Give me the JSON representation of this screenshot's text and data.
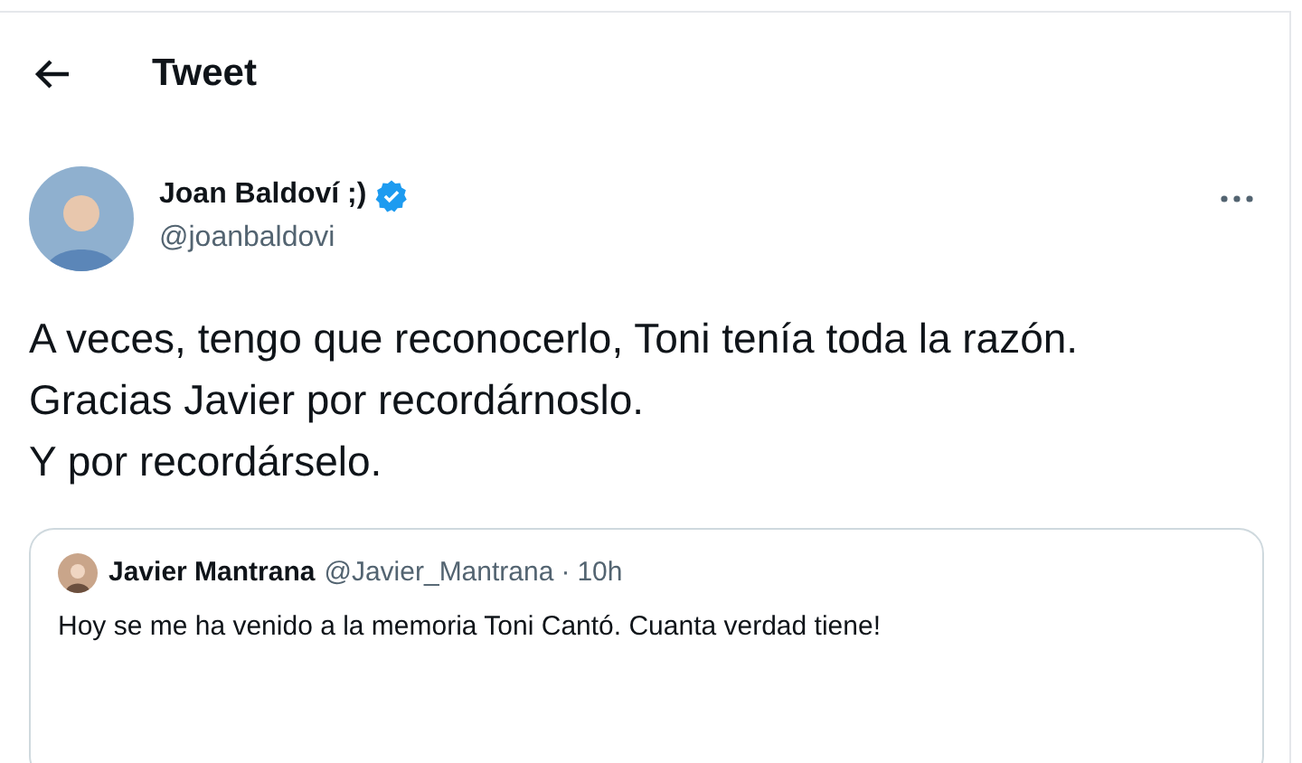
{
  "header": {
    "title": "Tweet"
  },
  "author": {
    "name": "Joan Baldoví ;)",
    "handle": "@joanbaldovi",
    "verified": true
  },
  "tweet_lines": [
    "A veces, tengo que reconocerlo, Toni tenía toda la razón.",
    "Gracias Javier por recordárnoslo.",
    "Y por recordárselo."
  ],
  "quoted_tweet": {
    "name": "Javier Mantrana",
    "handle": "@Javier_Mantrana",
    "separator": "·",
    "time": "10h",
    "text": "Hoy se me ha venido a la memoria Toni Cantó. Cuanta verdad tiene!"
  }
}
